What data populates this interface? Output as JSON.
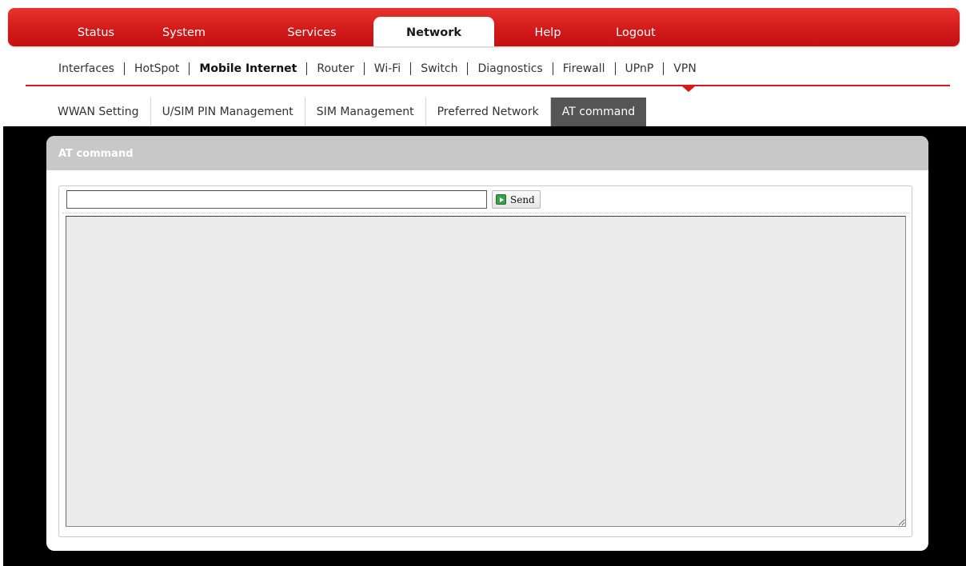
{
  "main_nav": {
    "tabs": [
      {
        "label": "Status"
      },
      {
        "label": "System"
      },
      {
        "label": "Services"
      },
      {
        "label": "Network",
        "active": true
      },
      {
        "label": "Help"
      },
      {
        "label": "Logout"
      }
    ]
  },
  "sub_nav": {
    "items": [
      {
        "label": "Interfaces"
      },
      {
        "label": "HotSpot"
      },
      {
        "label": "Mobile Internet",
        "active": true
      },
      {
        "label": "Router"
      },
      {
        "label": "Wi-Fi"
      },
      {
        "label": "Switch"
      },
      {
        "label": "Diagnostics"
      },
      {
        "label": "Firewall"
      },
      {
        "label": "UPnP"
      },
      {
        "label": "VPN"
      }
    ]
  },
  "third_nav": {
    "tabs": [
      {
        "label": "WWAN Setting"
      },
      {
        "label": "U/SIM PIN Management"
      },
      {
        "label": "SIM Management"
      },
      {
        "label": "Preferred Network"
      },
      {
        "label": "AT command",
        "active": true
      }
    ]
  },
  "panel": {
    "title": "AT command",
    "command_input": {
      "value": "",
      "placeholder": ""
    },
    "send_label": "Send",
    "send_icon": "play-icon",
    "output": {
      "value": ""
    }
  },
  "colors": {
    "brand_red": "#d31a1a",
    "active_subtab": "#555555",
    "panel_header": "#c8c8c8"
  }
}
